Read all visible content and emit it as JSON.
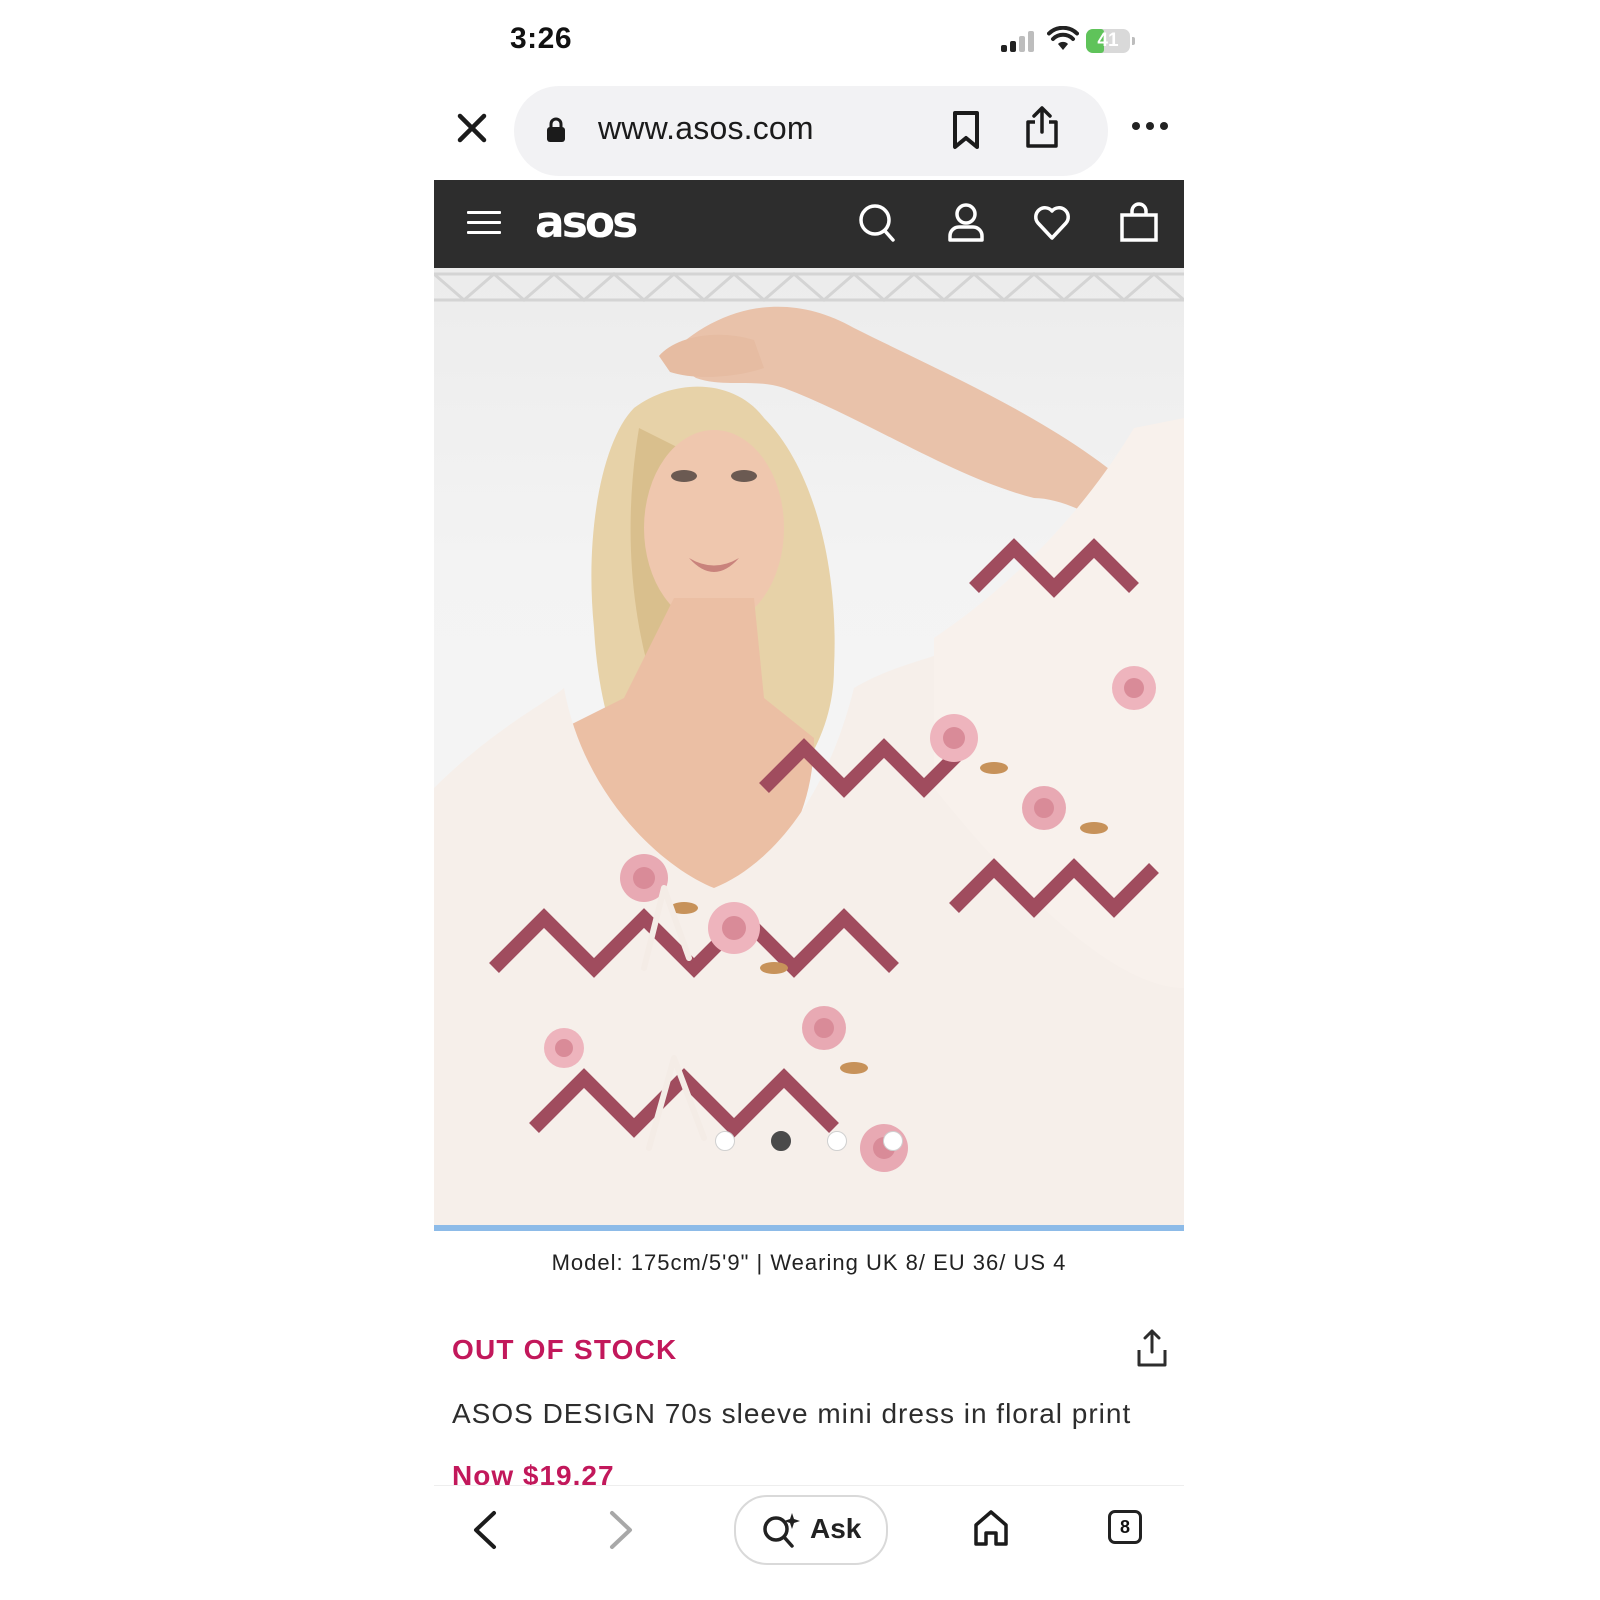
{
  "status_bar": {
    "time": "3:26",
    "battery": "41"
  },
  "browser": {
    "url": "www.asos.com"
  },
  "site": {
    "logo": "asos"
  },
  "product": {
    "model_info": "Model: 175cm/5'9\" | Wearing UK 8/ EU 36/ US 4",
    "stock_status": "OUT OF STOCK",
    "title": "ASOS DESIGN 70s sleeve mini dress in floral print",
    "price": "Now $19.27",
    "carousel": {
      "count": 4,
      "active_index": 1
    }
  },
  "toolbar": {
    "ask_label": "Ask",
    "tabs_count": "8"
  },
  "colors": {
    "accent_pink": "#c2185b",
    "header_bg": "#2d2d2d",
    "battery_green": "#5fc35a",
    "scroll_bar": "#8dbbe8"
  },
  "icons": [
    "close-icon",
    "lock-icon",
    "bookmark-icon",
    "share-icon",
    "more-icon",
    "menu-icon",
    "search-icon",
    "account-icon",
    "heart-icon",
    "bag-icon",
    "back-icon",
    "forward-icon",
    "ask-search-icon",
    "home-icon",
    "tabs-icon"
  ]
}
